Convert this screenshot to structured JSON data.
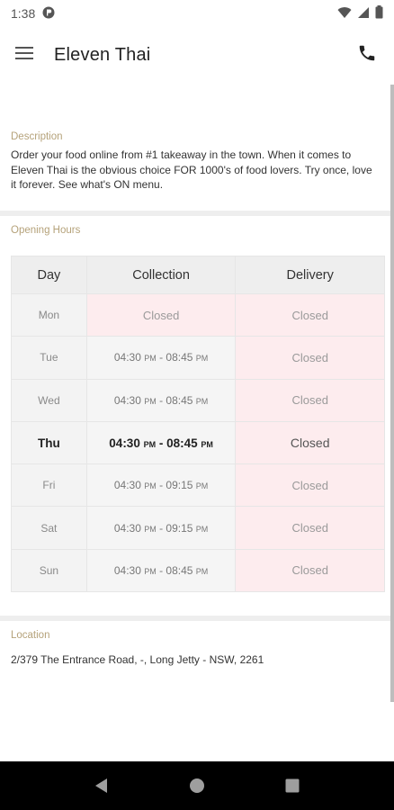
{
  "status_bar": {
    "time": "1:38",
    "icons": [
      "notification-circle-icon",
      "wifi-icon",
      "cell-signal-icon",
      "battery-icon"
    ]
  },
  "app_bar": {
    "title": "Eleven Thai",
    "menu_icon": "menu-icon",
    "phone_icon": "phone-icon"
  },
  "description": {
    "label": "Description",
    "text": "Order your food online from #1 takeaway in the town. When it comes to Eleven Thai is the obvious choice FOR 1000's of food lovers. Try once, love it forever. See what's ON menu."
  },
  "opening_hours": {
    "label": "Opening Hours",
    "headers": [
      "Day",
      "Collection",
      "Delivery"
    ],
    "rows": [
      {
        "day": "Mon",
        "collection_open": "",
        "collection_close": "",
        "collection": "Closed",
        "delivery": "Closed"
      },
      {
        "day": "Tue",
        "collection_open": "04:30",
        "collection_close": "08:45",
        "collection": "",
        "delivery": "Closed"
      },
      {
        "day": "Wed",
        "collection_open": "04:30",
        "collection_close": "08:45",
        "collection": "",
        "delivery": "Closed"
      },
      {
        "day": "Thu",
        "collection_open": "04:30",
        "collection_close": "08:45",
        "collection": "",
        "delivery": "Closed"
      },
      {
        "day": "Fri",
        "collection_open": "04:30",
        "collection_close": "09:15",
        "collection": "",
        "delivery": "Closed"
      },
      {
        "day": "Sat",
        "collection_open": "04:30",
        "collection_close": "09:15",
        "collection": "",
        "delivery": "Closed"
      },
      {
        "day": "Sun",
        "collection_open": "04:30",
        "collection_close": "08:45",
        "collection": "",
        "delivery": "Closed"
      }
    ],
    "pm_label": "PM",
    "separator": " - "
  },
  "location": {
    "label": "Location",
    "address": "2/379 The Entrance Road, -, Long Jetty - NSW, 2261"
  },
  "nav": {
    "back_icon": "back-triangle-icon",
    "home_icon": "home-circle-icon",
    "recents_icon": "recents-square-icon"
  },
  "colors": {
    "section_label": "#b5a27a",
    "closed_bg": "#fdecee",
    "header_bg": "#eeeeee"
  }
}
